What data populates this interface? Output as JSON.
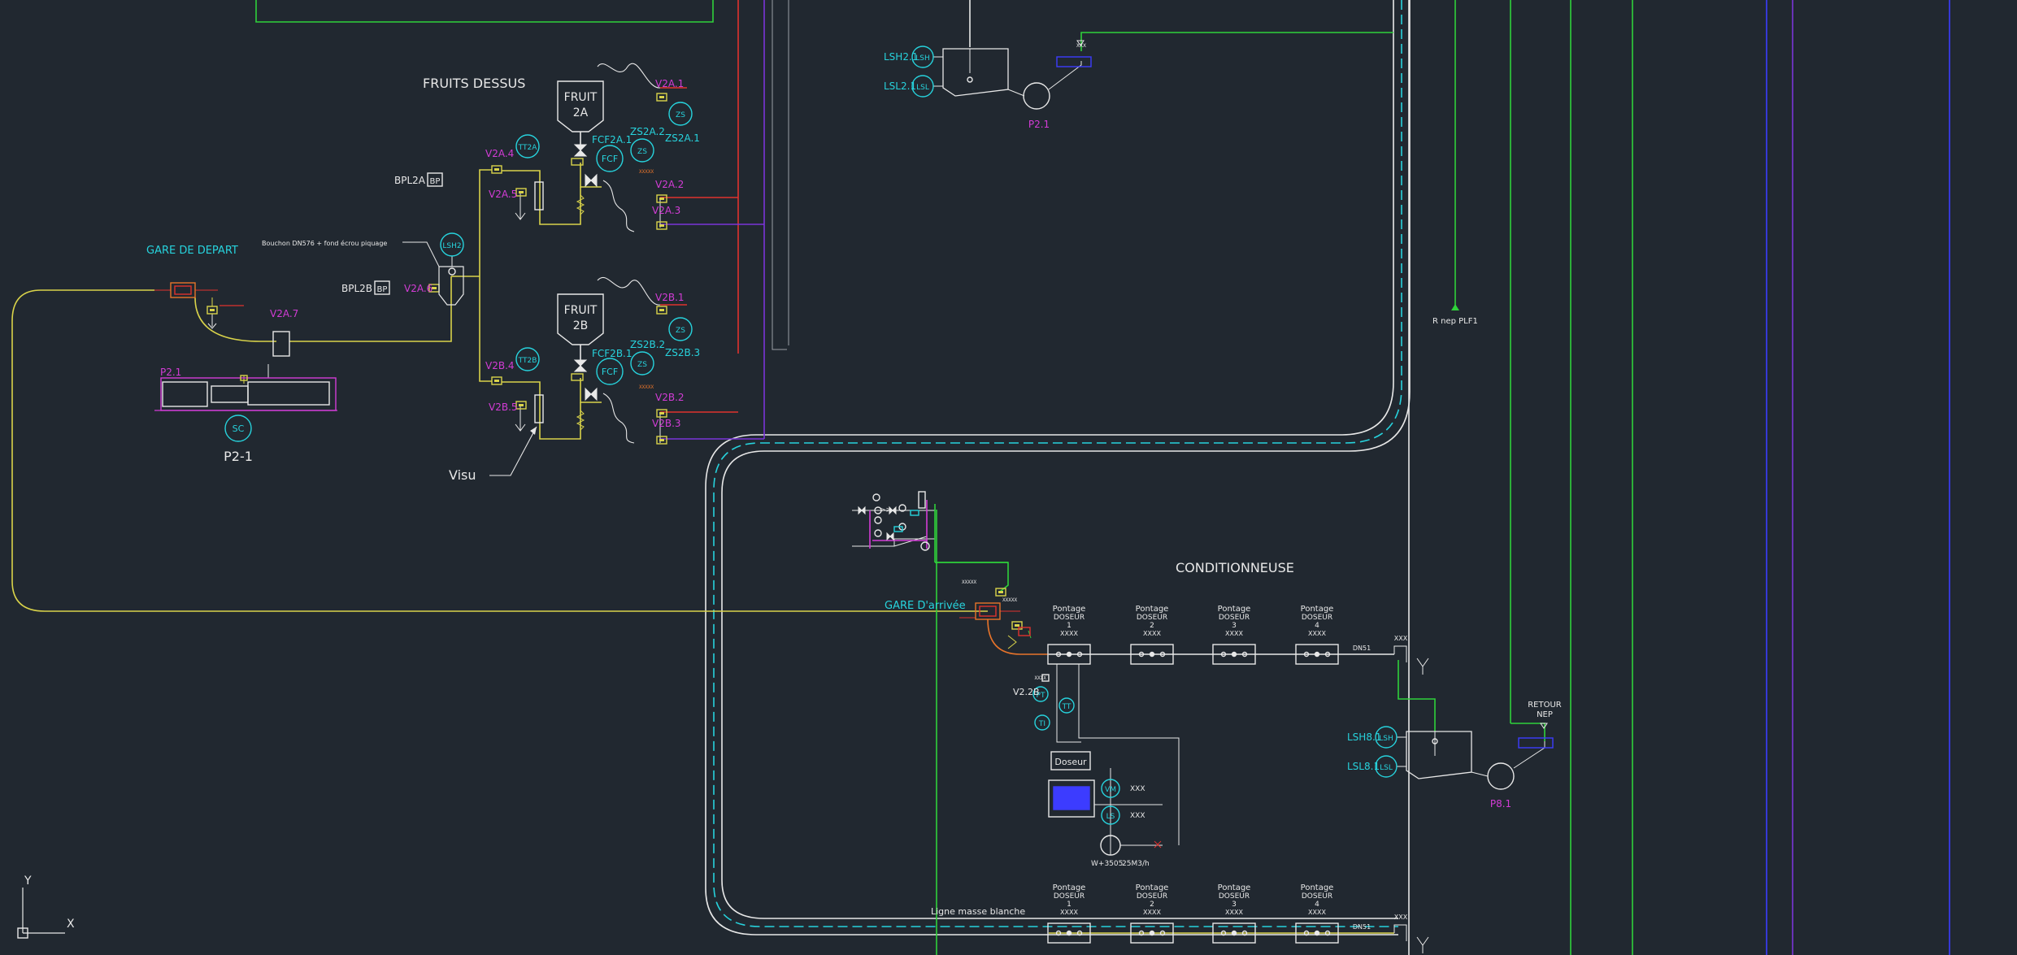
{
  "colors": {
    "background": "#212830",
    "white": "#e8e8e8",
    "cyan": "#27d3dd",
    "magenta": "#d33cd6",
    "yellow": "#d9d34a",
    "green": "#2fd13a",
    "red": "#e0322e",
    "blue": "#3c3cff",
    "purple": "#7a34d8",
    "orange": "#e8742a",
    "grey": "#9aa0a6"
  },
  "titles": {
    "fruits_dessus": "FRUITS DESSUS",
    "conditionneuse": "CONDITIONNEUSE",
    "gare_depart": "GARE DE DEPART",
    "gare_arrivee": "GARE D'arrivée",
    "retour_nep": [
      "RETOUR",
      "NEP"
    ],
    "r_nep": "R nep PLF1",
    "ligne_masse": "Ligne masse blanche",
    "visu": "Visu",
    "bouchon_note": "Bouchon DN576 + fond écrou piquage",
    "p2_1": "P2-1",
    "p21_small": "P2.1",
    "p2_1_top": "P2.1",
    "p8_1": "P8.1"
  },
  "hoppers": {
    "a": [
      "FRUIT",
      "2A"
    ],
    "b": [
      "FRUIT",
      "2B"
    ]
  },
  "instruments": {
    "tt2a": "TT2A",
    "tt2b": "TT2B",
    "lsh2": "LSH2",
    "zs": "ZS",
    "fcf": "FCF",
    "lsh": "LSH",
    "lsl": "LSL",
    "sc": "SC",
    "pt": "PT",
    "tt": "TT",
    "ti": "TI"
  },
  "tags": {
    "v2a1": "V2A.1",
    "zs2a2": "ZS2A.2",
    "zs2a1": "ZS2A.1",
    "fcf2a1": "FCF2A.1",
    "v2a2": "V2A.2",
    "v2a3": "V2A.3",
    "v2a4": "V2A.4",
    "v2a5": "V2A.5",
    "v2a6": "V2A.6",
    "v2a7": "V2A.7",
    "v2b1": "V2B.1",
    "zs2b2": "ZS2B.2",
    "zs2b3": "ZS2B.3",
    "fcf2b1": "FCF2B.1",
    "v2b2": "V2B.2",
    "v2b3": "V2B.3",
    "v2b4": "V2B.4",
    "v2b5": "V2B.5",
    "bpl2a": "BPL2A",
    "bpl2b": "BPL2B",
    "bp": "BP",
    "lsh21": "LSH2.1",
    "lsl21": "LSL2.1",
    "lsh81": "LSH8.1",
    "lsl81": "LSL8.1",
    "v22b": "V2.2B",
    "dn51": "DN51",
    "xxx": "XXX",
    "w3505": "W+3505",
    "flow": "25M3/h"
  },
  "doseurs": {
    "heading": [
      "Pontage",
      "DOSEUR"
    ],
    "numbers": [
      "1",
      "2",
      "3",
      "4"
    ],
    "code": "XXXX"
  },
  "dosing_skid": {
    "doseur_label": "Doseur"
  },
  "axes": {
    "x": "X",
    "y": "Y"
  }
}
